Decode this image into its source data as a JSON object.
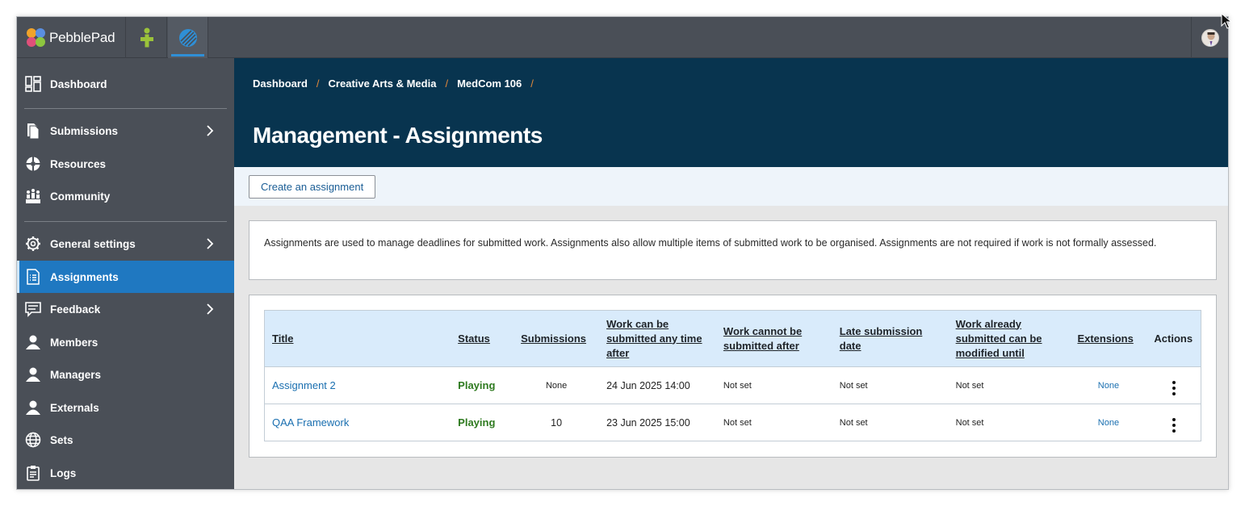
{
  "brand": {
    "name": "PebblePad"
  },
  "sidebar": {
    "items": [
      {
        "label": "Dashboard",
        "icon": "dashboard-icon"
      },
      {
        "label": "Submissions",
        "icon": "submissions-icon",
        "has_children": true
      },
      {
        "label": "Resources",
        "icon": "resources-icon"
      },
      {
        "label": "Community",
        "icon": "community-icon"
      },
      {
        "label": "General settings",
        "icon": "gear-icon",
        "has_children": true
      },
      {
        "label": "Assignments",
        "icon": "assignments-icon",
        "active": true
      },
      {
        "label": "Feedback",
        "icon": "feedback-icon",
        "has_children": true
      },
      {
        "label": "Members",
        "icon": "person-icon"
      },
      {
        "label": "Managers",
        "icon": "person-icon"
      },
      {
        "label": "Externals",
        "icon": "person-icon"
      },
      {
        "label": "Sets",
        "icon": "globe-icon"
      },
      {
        "label": "Logs",
        "icon": "clipboard-icon"
      }
    ]
  },
  "breadcrumb": [
    "Dashboard",
    "Creative Arts & Media",
    "MedCom 106"
  ],
  "page": {
    "title": "Management - Assignments"
  },
  "toolbar": {
    "create_label": "Create an assignment"
  },
  "info": {
    "text": "Assignments are used to manage deadlines for submitted work. Assignments also allow multiple items of submitted work to be organised. Assignments are not required if work is not formally assessed."
  },
  "table": {
    "headers": {
      "title": "Title",
      "status": "Status",
      "submissions": "Submissions",
      "open": "Work can be submitted any time after",
      "close": "Work cannot be submitted after",
      "late": "Late submission date",
      "modify": "Work already submitted can be modified until",
      "extensions": "Extensions",
      "actions": "Actions"
    },
    "rows": [
      {
        "title": "Assignment 2",
        "status": "Playing",
        "submissions": "None",
        "open": "24 Jun 2025 14:00",
        "close": "Not set",
        "late": "Not set",
        "modify": "Not set",
        "extensions": "None"
      },
      {
        "title": "QAA Framework",
        "status": "Playing",
        "submissions": "10",
        "open": "23 Jun 2025 15:00",
        "close": "Not set",
        "late": "Not set",
        "modify": "Not set",
        "extensions": "None"
      }
    ]
  },
  "colors": {
    "topbar": "#4a4f57",
    "hero": "#08344f",
    "active_nav": "#1f78c1",
    "playing": "#2e7a1f",
    "link": "#1a6fb0",
    "breadcrumb_sep": "#e58a3a"
  }
}
